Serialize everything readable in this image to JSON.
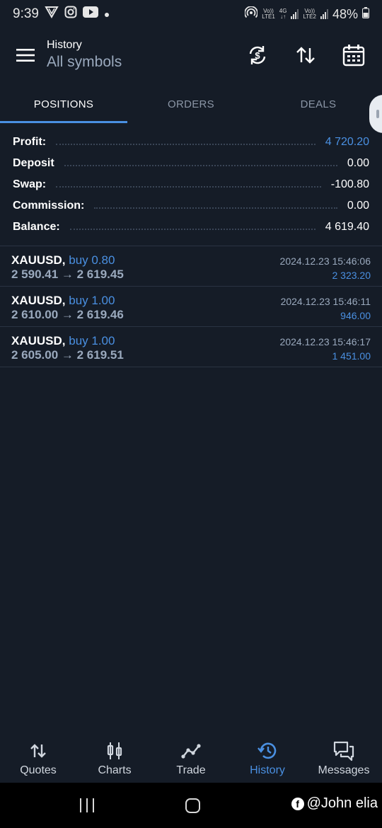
{
  "status_bar": {
    "time": "9:39",
    "sim1_top": "Vo))",
    "sim1_bottom": "LTE1",
    "net_type": "4G",
    "sim2_top": "Vo))",
    "sim2_bottom": "LTE2",
    "battery": "48%"
  },
  "header": {
    "title": "History",
    "subtitle": "All symbols",
    "icons": [
      "menu-icon",
      "currency-exchange-icon",
      "sort-icon",
      "calendar-icon"
    ]
  },
  "tabs": [
    {
      "label": "POSITIONS",
      "active": true
    },
    {
      "label": "ORDERS",
      "active": false
    },
    {
      "label": "DEALS",
      "active": false
    }
  ],
  "summary": [
    {
      "label": "Profit:",
      "value": "4 720.20"
    },
    {
      "label": "Deposit",
      "value": "0.00"
    },
    {
      "label": "Swap:",
      "value": "-100.80"
    },
    {
      "label": "Commission:",
      "value": "0.00"
    },
    {
      "label": "Balance:",
      "value": "4 619.40"
    }
  ],
  "positions": [
    {
      "symbol": "XAUUSD,",
      "direction": "buy 0.80",
      "prices": "2 590.41 → 2 619.45",
      "time": "2024.12.23 15:46:06",
      "profit": "2 323.20"
    },
    {
      "symbol": "XAUUSD,",
      "direction": "buy 1.00",
      "prices": "2 610.00 → 2 619.46",
      "time": "2024.12.23 15:46:11",
      "profit": "946.00"
    },
    {
      "symbol": "XAUUSD,",
      "direction": "buy 1.00",
      "prices": "2 605.00 → 2 619.51",
      "time": "2024.12.23 15:46:17",
      "profit": "1 451.00"
    }
  ],
  "bottom_nav": [
    {
      "label": "Quotes",
      "icon": "quotes-icon",
      "active": false
    },
    {
      "label": "Charts",
      "icon": "charts-icon",
      "active": false
    },
    {
      "label": "Trade",
      "icon": "trade-icon",
      "active": false
    },
    {
      "label": "History",
      "icon": "history-icon",
      "active": true
    },
    {
      "label": "Messages",
      "icon": "messages-icon",
      "active": false
    }
  ],
  "watermark": "@John elia",
  "colors": {
    "background": "#151c27",
    "accent": "#4a90e2",
    "muted": "#9aa9bd"
  }
}
